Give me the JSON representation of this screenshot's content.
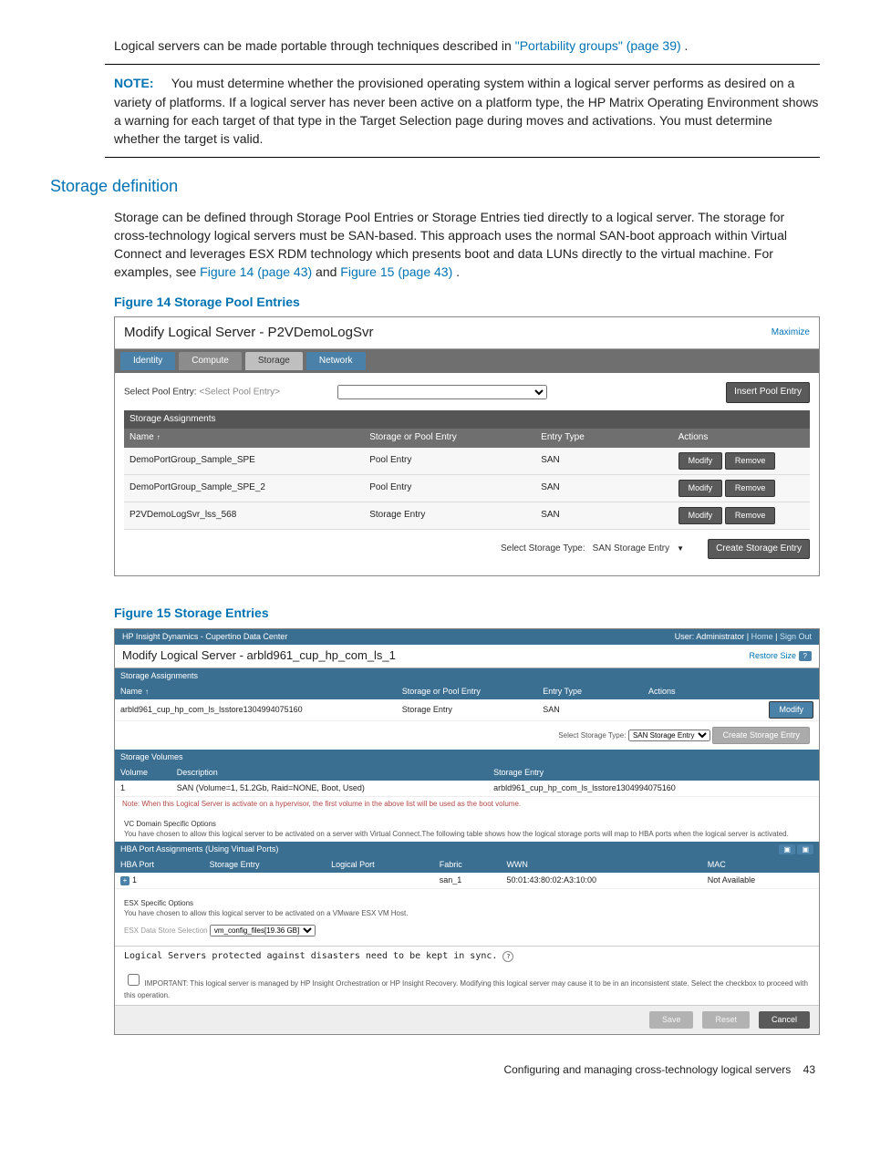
{
  "intro_text_part1": "Logical servers can be made portable through techniques described in ",
  "intro_link": "\"Portability groups\" (page 39)",
  "intro_text_part2": ".",
  "note_label": "NOTE:",
  "note_text": "You must determine whether the provisioned operating system within a logical server performs as desired on a variety of platforms. If a logical server has never been active on a platform type, the HP Matrix Operating Environment shows a warning for each target of that type in the Target Selection page during moves and activations. You must determine whether the target is valid.",
  "h2_storage": "Storage definition",
  "storage_p1_a": "Storage can be defined through Storage Pool Entries or Storage Entries tied directly to a logical server. The storage for cross-technology logical servers must be SAN-based. This approach uses the normal SAN-boot approach within Virtual Connect and leverages ESX RDM technology which presents boot and data LUNs directly to the virtual machine. For examples, see ",
  "storage_link1": "Figure 14 (page 43)",
  "storage_p1_b": " and ",
  "storage_link2": "Figure 15 (page 43)",
  "storage_p1_c": ".",
  "fig14_title": "Figure 14 Storage Pool Entries",
  "fig15_title": "Figure 15 Storage Entries",
  "fig14": {
    "header": "Modify Logical Server - P2VDemoLogSvr",
    "maximize": "Maximize",
    "tabs": [
      "Identity",
      "Compute",
      "Storage",
      "Network"
    ],
    "select_pool_label": "Select Pool Entry:",
    "select_pool_placeholder": "<Select Pool Entry>",
    "insert_btn": "Insert Pool Entry",
    "section": "Storage Assignments",
    "cols": [
      "Name",
      "Storage or Pool Entry",
      "Entry Type",
      "Actions"
    ],
    "rows": [
      {
        "name": "DemoPortGroup_Sample_SPE",
        "spe": "Pool Entry",
        "etype": "SAN"
      },
      {
        "name": "DemoPortGroup_Sample_SPE_2",
        "spe": "Pool Entry",
        "etype": "SAN"
      },
      {
        "name": "P2VDemoLogSvr_lss_568",
        "spe": "Storage Entry",
        "etype": "SAN"
      }
    ],
    "modify": "Modify",
    "remove": "Remove",
    "select_storage_type_label": "Select Storage Type:",
    "select_storage_type_value": "SAN Storage Entry",
    "create_storage_btn": "Create Storage Entry"
  },
  "fig15": {
    "topbar_left": "HP Insight Dynamics - Cupertino Data Center",
    "topbar_right_user": "User: Administrator",
    "topbar_home": "Home",
    "topbar_signout": "Sign Out",
    "header": "Modify Logical Server - arbld961_cup_hp_com_ls_1",
    "restore": "Restore Size",
    "sect_assign": "Storage Assignments",
    "assign_cols": [
      "Name",
      "Storage or Pool Entry",
      "Entry Type",
      "Actions"
    ],
    "assign_row": {
      "name": "arbld961_cup_hp_com_ls_lsstore1304994075160",
      "spe": "Storage Entry",
      "etype": "SAN"
    },
    "modify": "Modify",
    "sel_stor_type_label": "Select Storage Type:",
    "sel_stor_type_value": "SAN Storage Entry",
    "create_btn_disabled": "Create Storage Entry",
    "sect_vol": "Storage Volumes",
    "vol_cols": [
      "Volume",
      "Description",
      "Storage Entry"
    ],
    "vol_row": {
      "vol": "1",
      "desc": "SAN (Volume=1, 51.2Gb, Raid=NONE, Boot, Used)",
      "sto": "arbld961_cup_hp_com_ls_lsstore1304994075160"
    },
    "vol_note": "Note: When this Logical Server is activate on a hypervisor, the first volume in the above list will be used as the boot volume.",
    "vc_head": "VC Domain Specific Options",
    "vc_text": "You have chosen to allow this logical server to be activated on a server with Virtual Connect.The following table shows how the logical storage ports will map to HBA ports when the logical server is activated.",
    "hba_section": "HBA Port Assignments (Using Virtual Ports)",
    "hba_cols": [
      "HBA Port",
      "Storage Entry",
      "Logical Port",
      "Fabric",
      "WWN",
      "MAC"
    ],
    "hba_row": {
      "port": "1",
      "fabric": "san_1",
      "wwn": "50:01:43:80:02:A3:10:00",
      "mac": "Not Available"
    },
    "esx_head": "ESX Specific Options",
    "esx_text": "You have chosen to allow this logical server to be activated on a VMware ESX VM Host.",
    "esx_ds_label": "ESX Data Store Selection",
    "esx_ds_value": "vm_config_files[19.36 GB]",
    "sync_text": "Logical Servers protected against disasters need to be kept in sync.",
    "important": "IMPORTANT: This logical server is managed by HP Insight Orchestration or HP Insight Recovery. Modifying this logical server may cause it to be in an inconsistent state. Select the checkbox to proceed with this operation.",
    "cancel": "Cancel",
    "save": "Save",
    "reset": "Reset"
  },
  "footer": "Configuring and managing cross-technology logical servers",
  "page_num": "43"
}
